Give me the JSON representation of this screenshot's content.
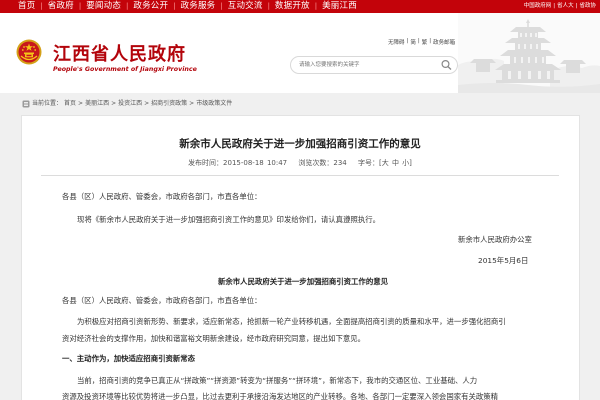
{
  "topnav": {
    "items": [
      "首页",
      "省政府",
      "要闻动态",
      "政务公开",
      "政务服务",
      "互动交流",
      "数据开放",
      "美丽江西"
    ],
    "right": [
      "中国政府网",
      "|",
      "省人大",
      "|",
      "省政协"
    ]
  },
  "header": {
    "title": "江西省人民政府",
    "subtitle": "People's Government of Jiangxi Province",
    "links": [
      "无障碍",
      "|",
      "简",
      "|",
      "繁",
      "|",
      "政务邮箱"
    ],
    "search_placeholder": "请输入您要搜索的关键字"
  },
  "breadcrumb": [
    "当前位置：",
    "首页",
    ">",
    "美丽江西",
    ">",
    "投资江西",
    ">",
    "招商引资政策",
    ">",
    "市级政策文件"
  ],
  "article": {
    "title": "新余市人民政府关于进一步加强招商引资工作的意见",
    "meta": {
      "published": "发布时间：2015-08-18 10:47",
      "views": "浏览次数：234",
      "fontsize": "字号：[大 中 小]"
    },
    "paragraphs": [
      "各县（区）人民政府、管委会，市政府各部门，市直各单位：",
      "现将《新余市人民政府关于进一步加强招商引资工作的意见》印发给你们，请认真遵照执行。",
      "新余市人民政府办公室",
      "2015年5月6日",
      "新余市人民政府关于进一步加强招商引资工作的意见",
      "各县（区）人民政府、管委会，市政府各部门，市直各单位：",
      "为积极应对招商引资新形势、新要求，适应新常态，抢抓新一轮产业转移机遇，全面提高招商引资的质量和水平，进一步强化招商引",
      "资对经济社会的支撑作用，加快和谐富裕文明新余建设，经市政府研究同意，提出如下意见。",
      "一、主动作为，加快适应招商引资新常态",
      "当前，招商引资的竞争已真正从“拼政策”“拼资源”转变为“拼服务”“拼环境”，新常态下，我市的交通区位、工业基础、人力",
      "资源及投资环境等比较优势将进一步凸显，比过去更利于承接沿海发达地区的产业转移。各地、各部门一定要深入领会国家有关政策精"
    ]
  }
}
